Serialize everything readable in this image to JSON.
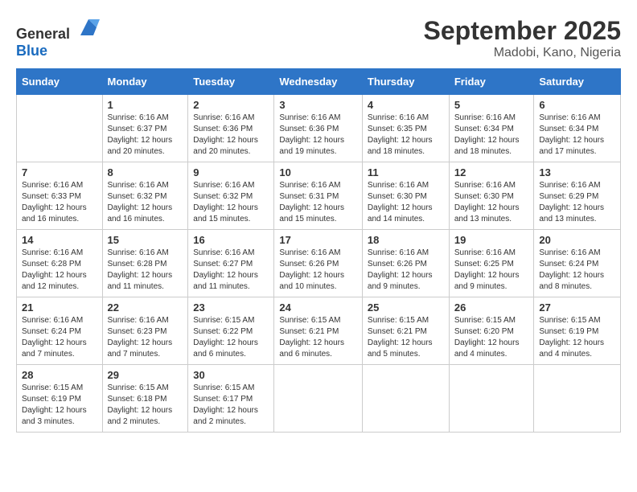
{
  "logo": {
    "text_general": "General",
    "text_blue": "Blue"
  },
  "title": "September 2025",
  "subtitle": "Madobi, Kano, Nigeria",
  "days_of_week": [
    "Sunday",
    "Monday",
    "Tuesday",
    "Wednesday",
    "Thursday",
    "Friday",
    "Saturday"
  ],
  "weeks": [
    [
      {
        "day": "",
        "info": ""
      },
      {
        "day": "1",
        "info": "Sunrise: 6:16 AM\nSunset: 6:37 PM\nDaylight: 12 hours\nand 20 minutes."
      },
      {
        "day": "2",
        "info": "Sunrise: 6:16 AM\nSunset: 6:36 PM\nDaylight: 12 hours\nand 20 minutes."
      },
      {
        "day": "3",
        "info": "Sunrise: 6:16 AM\nSunset: 6:36 PM\nDaylight: 12 hours\nand 19 minutes."
      },
      {
        "day": "4",
        "info": "Sunrise: 6:16 AM\nSunset: 6:35 PM\nDaylight: 12 hours\nand 18 minutes."
      },
      {
        "day": "5",
        "info": "Sunrise: 6:16 AM\nSunset: 6:34 PM\nDaylight: 12 hours\nand 18 minutes."
      },
      {
        "day": "6",
        "info": "Sunrise: 6:16 AM\nSunset: 6:34 PM\nDaylight: 12 hours\nand 17 minutes."
      }
    ],
    [
      {
        "day": "7",
        "info": "Sunrise: 6:16 AM\nSunset: 6:33 PM\nDaylight: 12 hours\nand 16 minutes."
      },
      {
        "day": "8",
        "info": "Sunrise: 6:16 AM\nSunset: 6:32 PM\nDaylight: 12 hours\nand 16 minutes."
      },
      {
        "day": "9",
        "info": "Sunrise: 6:16 AM\nSunset: 6:32 PM\nDaylight: 12 hours\nand 15 minutes."
      },
      {
        "day": "10",
        "info": "Sunrise: 6:16 AM\nSunset: 6:31 PM\nDaylight: 12 hours\nand 15 minutes."
      },
      {
        "day": "11",
        "info": "Sunrise: 6:16 AM\nSunset: 6:30 PM\nDaylight: 12 hours\nand 14 minutes."
      },
      {
        "day": "12",
        "info": "Sunrise: 6:16 AM\nSunset: 6:30 PM\nDaylight: 12 hours\nand 13 minutes."
      },
      {
        "day": "13",
        "info": "Sunrise: 6:16 AM\nSunset: 6:29 PM\nDaylight: 12 hours\nand 13 minutes."
      }
    ],
    [
      {
        "day": "14",
        "info": "Sunrise: 6:16 AM\nSunset: 6:28 PM\nDaylight: 12 hours\nand 12 minutes."
      },
      {
        "day": "15",
        "info": "Sunrise: 6:16 AM\nSunset: 6:28 PM\nDaylight: 12 hours\nand 11 minutes."
      },
      {
        "day": "16",
        "info": "Sunrise: 6:16 AM\nSunset: 6:27 PM\nDaylight: 12 hours\nand 11 minutes."
      },
      {
        "day": "17",
        "info": "Sunrise: 6:16 AM\nSunset: 6:26 PM\nDaylight: 12 hours\nand 10 minutes."
      },
      {
        "day": "18",
        "info": "Sunrise: 6:16 AM\nSunset: 6:26 PM\nDaylight: 12 hours\nand 9 minutes."
      },
      {
        "day": "19",
        "info": "Sunrise: 6:16 AM\nSunset: 6:25 PM\nDaylight: 12 hours\nand 9 minutes."
      },
      {
        "day": "20",
        "info": "Sunrise: 6:16 AM\nSunset: 6:24 PM\nDaylight: 12 hours\nand 8 minutes."
      }
    ],
    [
      {
        "day": "21",
        "info": "Sunrise: 6:16 AM\nSunset: 6:24 PM\nDaylight: 12 hours\nand 7 minutes."
      },
      {
        "day": "22",
        "info": "Sunrise: 6:16 AM\nSunset: 6:23 PM\nDaylight: 12 hours\nand 7 minutes."
      },
      {
        "day": "23",
        "info": "Sunrise: 6:15 AM\nSunset: 6:22 PM\nDaylight: 12 hours\nand 6 minutes."
      },
      {
        "day": "24",
        "info": "Sunrise: 6:15 AM\nSunset: 6:21 PM\nDaylight: 12 hours\nand 6 minutes."
      },
      {
        "day": "25",
        "info": "Sunrise: 6:15 AM\nSunset: 6:21 PM\nDaylight: 12 hours\nand 5 minutes."
      },
      {
        "day": "26",
        "info": "Sunrise: 6:15 AM\nSunset: 6:20 PM\nDaylight: 12 hours\nand 4 minutes."
      },
      {
        "day": "27",
        "info": "Sunrise: 6:15 AM\nSunset: 6:19 PM\nDaylight: 12 hours\nand 4 minutes."
      }
    ],
    [
      {
        "day": "28",
        "info": "Sunrise: 6:15 AM\nSunset: 6:19 PM\nDaylight: 12 hours\nand 3 minutes."
      },
      {
        "day": "29",
        "info": "Sunrise: 6:15 AM\nSunset: 6:18 PM\nDaylight: 12 hours\nand 2 minutes."
      },
      {
        "day": "30",
        "info": "Sunrise: 6:15 AM\nSunset: 6:17 PM\nDaylight: 12 hours\nand 2 minutes."
      },
      {
        "day": "",
        "info": ""
      },
      {
        "day": "",
        "info": ""
      },
      {
        "day": "",
        "info": ""
      },
      {
        "day": "",
        "info": ""
      }
    ]
  ]
}
